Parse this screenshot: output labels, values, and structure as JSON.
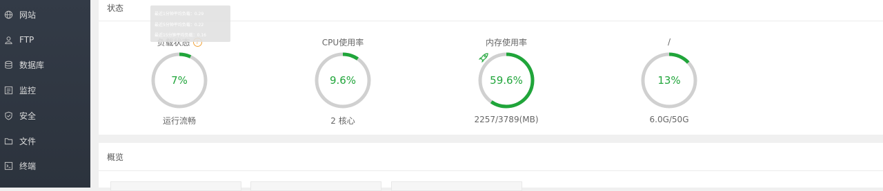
{
  "sidebar": {
    "items": [
      {
        "label": "网站",
        "icon": "globe-icon"
      },
      {
        "label": "FTP",
        "icon": "user-icon"
      },
      {
        "label": "数据库",
        "icon": "database-icon"
      },
      {
        "label": "监控",
        "icon": "monitor-icon"
      },
      {
        "label": "安全",
        "icon": "shield-icon"
      },
      {
        "label": "文件",
        "icon": "folder-icon"
      },
      {
        "label": "终端",
        "icon": "terminal-icon"
      }
    ]
  },
  "status": {
    "title": "状态",
    "gauges": [
      {
        "title": "负载状态",
        "value": "7%",
        "percent": 7,
        "sub": "运行流畅",
        "has_help": true
      },
      {
        "title": "CPU使用率",
        "value": "9.6%",
        "percent": 9.6,
        "sub": "2 核心"
      },
      {
        "title": "内存使用率",
        "value": "59.6%",
        "percent": 59.6,
        "sub": "2257/3789(MB)",
        "icon": "rocket-icon"
      },
      {
        "title": "/",
        "value": "13%",
        "percent": 13,
        "sub": "6.0G/50G"
      }
    ],
    "tooltip": {
      "lines": [
        "最近1分钟平均负载：0.29",
        "最近5分钟平均负载：0.22",
        "最近15分钟平均负载：0.16"
      ]
    }
  },
  "overview": {
    "title": "概览"
  },
  "colors": {
    "accent": "#20a53a",
    "ring_track": "#d0d0d0",
    "sidebar_bg": "#2f3640",
    "help": "#f0a33a"
  }
}
